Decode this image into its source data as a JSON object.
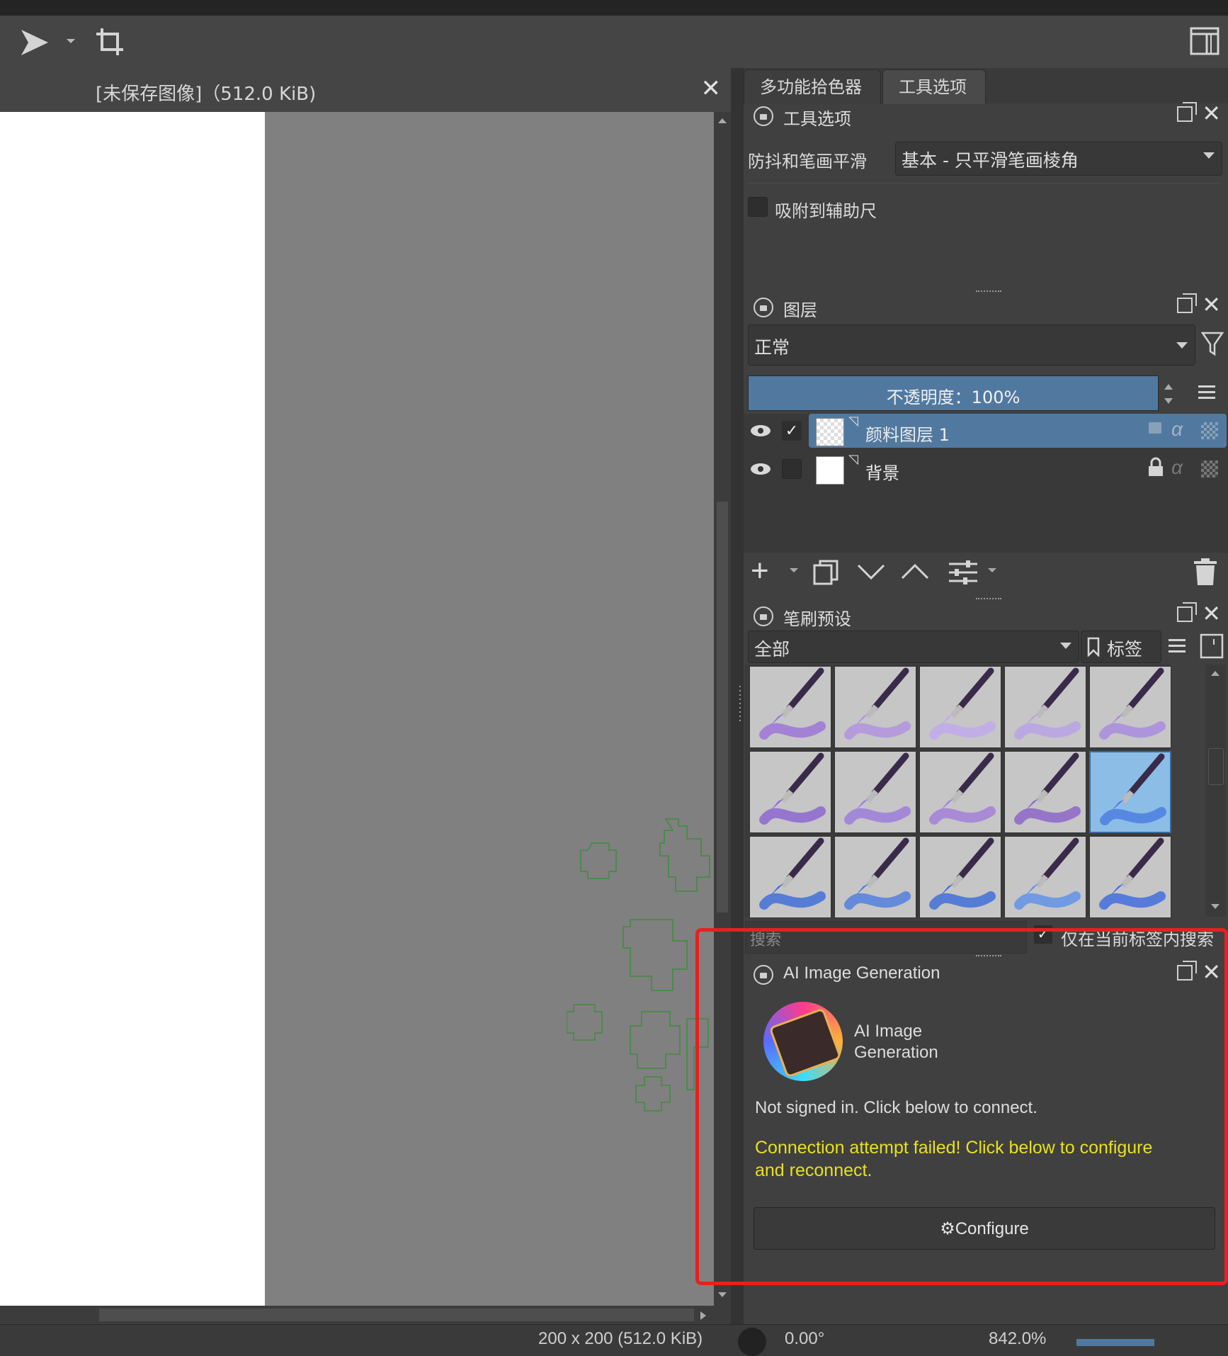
{
  "toolbar": {
    "left_icons": [
      "play-icon",
      "dropdown-arrow-icon",
      "crop-icon"
    ],
    "right_icon": "workspace-layout-icon"
  },
  "document": {
    "title": "[未保存图像]（512.0 KiB)",
    "close_icon": "close-icon"
  },
  "dock_tabs": [
    {
      "label": "多功能拾色器",
      "active": false
    },
    {
      "label": "工具选项",
      "active": true
    }
  ],
  "tool_options": {
    "panel_title": "工具选项",
    "smoothing_label": "防抖和笔画平滑",
    "smoothing_value": "基本 - 只平滑笔画棱角",
    "snap_label": "吸附到辅助尺"
  },
  "layers": {
    "panel_title": "图层",
    "blend_mode": "正常",
    "opacity_label": "不透明度：100%",
    "items": [
      {
        "name": "颜料图层 1",
        "selected": true,
        "checked": true,
        "locked": false
      },
      {
        "name": "背景",
        "selected": false,
        "checked": false,
        "locked": true
      }
    ]
  },
  "brush_presets": {
    "panel_title": "笔刷预设",
    "filter_value": "全部",
    "tag_label": "标签",
    "search_placeholder": "搜索",
    "search_in_tag_label": "仅在当前标签内搜索",
    "selected_index": 9,
    "count": 15
  },
  "ai_panel": {
    "panel_title": "AI Image Generation",
    "logo_text_line1": "AI Image",
    "logo_text_line2": "Generation",
    "status": "Not signed in. Click below to connect.",
    "error_line1": "Connection attempt failed! Click below to configure",
    "error_line2": "and reconnect.",
    "configure_label": "Configure"
  },
  "statusbar": {
    "size": "200 x 200 (512.0 KiB)",
    "rotation": "0.00°",
    "zoom": "842.0%"
  },
  "colors": {
    "accent": "#5179a0",
    "warning_text": "#e8e020",
    "highlight_box": "#e82020",
    "canvas_bg": "#808080"
  }
}
